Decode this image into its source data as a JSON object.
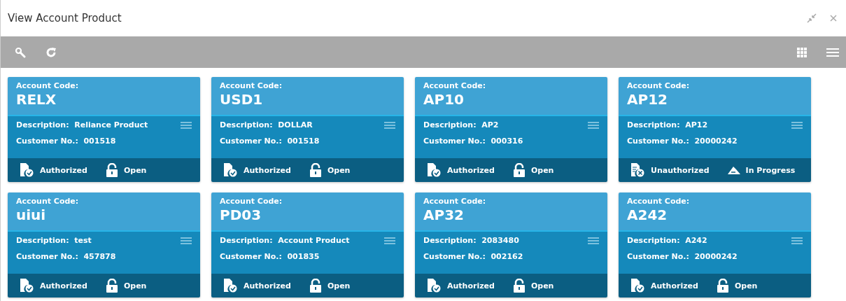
{
  "window": {
    "title": "View Account Product"
  },
  "cards": [
    {
      "code_label": "Account Code:",
      "code": "RELX",
      "description_label": "Description:",
      "description": "Reliance Product",
      "customer_label": "Customer No.:",
      "customer": "001518",
      "auth": {
        "kind": "authorized",
        "label": "Authorized"
      },
      "record": {
        "kind": "open",
        "label": "Open"
      }
    },
    {
      "code_label": "Account Code:",
      "code": "USD1",
      "description_label": "Description:",
      "description": "DOLLAR",
      "customer_label": "Customer No.:",
      "customer": "001518",
      "auth": {
        "kind": "authorized",
        "label": "Authorized"
      },
      "record": {
        "kind": "open",
        "label": "Open"
      }
    },
    {
      "code_label": "Account Code:",
      "code": "AP10",
      "description_label": "Description:",
      "description": "AP2",
      "customer_label": "Customer No.:",
      "customer": "000316",
      "auth": {
        "kind": "authorized",
        "label": "Authorized"
      },
      "record": {
        "kind": "open",
        "label": "Open"
      }
    },
    {
      "code_label": "Account Code:",
      "code": "AP12",
      "description_label": "Description:",
      "description": "AP12",
      "customer_label": "Customer No.:",
      "customer": "20000242",
      "auth": {
        "kind": "unauthorized",
        "label": "Unauthorized"
      },
      "record": {
        "kind": "in_progress",
        "label": "In Progress"
      }
    },
    {
      "code_label": "Account Code:",
      "code": "uiui",
      "description_label": "Description:",
      "description": "test",
      "customer_label": "Customer No.:",
      "customer": "457878",
      "auth": {
        "kind": "authorized",
        "label": "Authorized"
      },
      "record": {
        "kind": "open",
        "label": "Open"
      }
    },
    {
      "code_label": "Account Code:",
      "code": "PD03",
      "description_label": "Description:",
      "description": "Account Product",
      "customer_label": "Customer No.:",
      "customer": "001835",
      "auth": {
        "kind": "authorized",
        "label": "Authorized"
      },
      "record": {
        "kind": "open",
        "label": "Open"
      }
    },
    {
      "code_label": "Account Code:",
      "code": "AP32",
      "description_label": "Description:",
      "description": "2083480",
      "customer_label": "Customer No.:",
      "customer": "002162",
      "auth": {
        "kind": "authorized",
        "label": "Authorized"
      },
      "record": {
        "kind": "open",
        "label": "Open"
      }
    },
    {
      "code_label": "Account Code:",
      "code": "A242",
      "description_label": "Description:",
      "description": "A242",
      "customer_label": "Customer No.:",
      "customer": "20000242",
      "auth": {
        "kind": "authorized",
        "label": "Authorized"
      },
      "record": {
        "kind": "open",
        "label": "Open"
      }
    }
  ]
}
